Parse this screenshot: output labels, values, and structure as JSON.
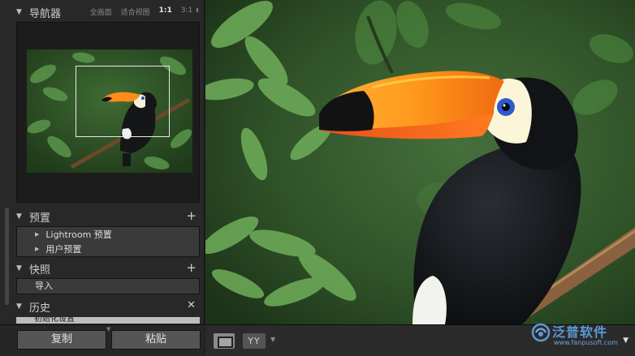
{
  "navigator": {
    "title": "导航器",
    "options": [
      "全画面",
      "适合视图",
      "1:1",
      "3:1"
    ],
    "active_option": "1:1",
    "dropdown_icon": "up-down-arrows-icon"
  },
  "presets": {
    "title": "预置",
    "items": [
      "Lightroom 预置",
      "用户预置"
    ]
  },
  "snapshots": {
    "title": "快照",
    "items": [
      "导入"
    ]
  },
  "history": {
    "title": "历史",
    "items": [
      "初始化设置"
    ]
  },
  "buttons": {
    "copy": "复制",
    "paste": "粘贴"
  },
  "toolbar": {
    "compare_label": "YY"
  },
  "watermark": {
    "brand": "泛普软件",
    "url": "www.fanpusoft.com"
  },
  "colors": {
    "panel_bg": "#282828",
    "header_text": "#cfcfcf",
    "row_bg": "#3a3a3a",
    "button_bg": "#555555",
    "watermark_blue": "#5b9ad8"
  }
}
